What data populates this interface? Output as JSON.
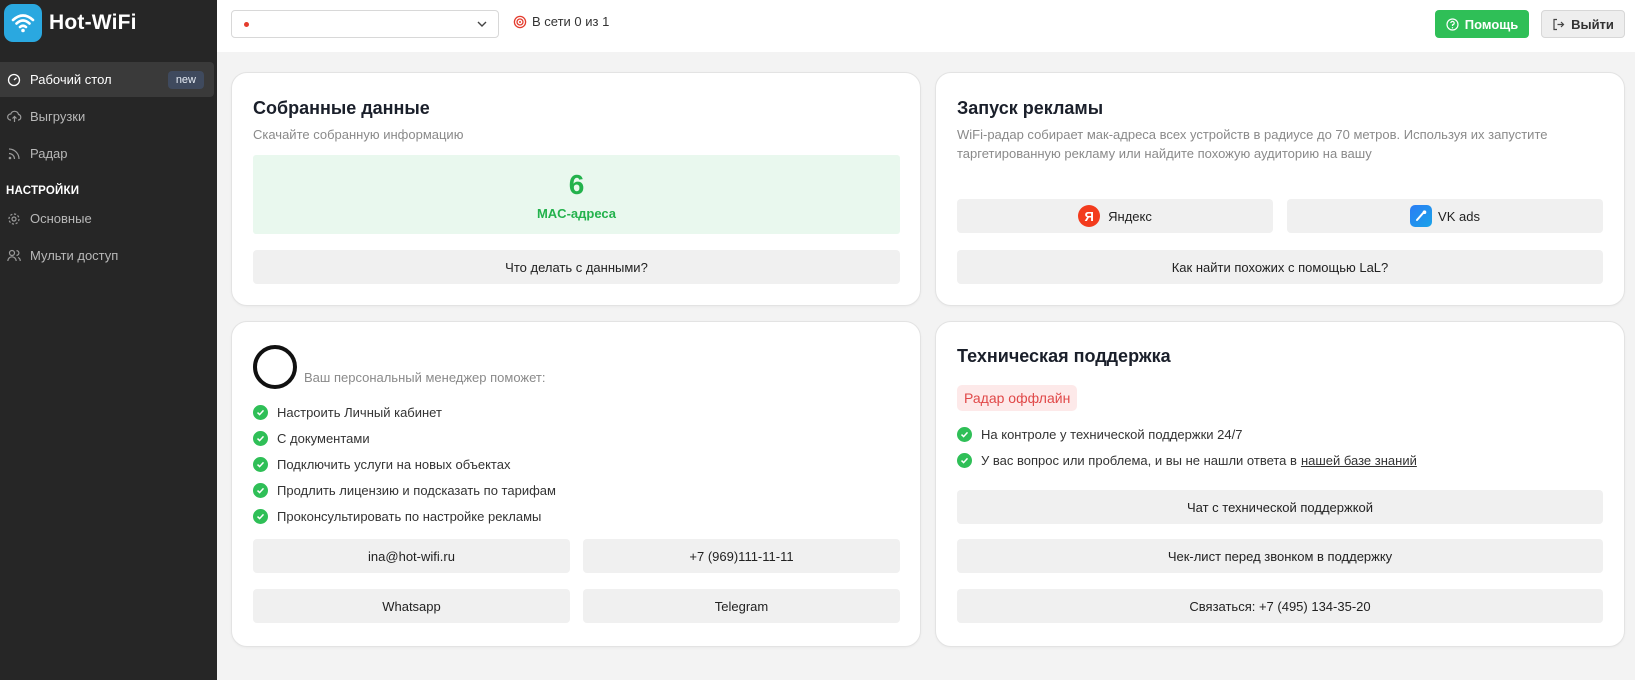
{
  "brand": {
    "name": "Hot-WiFi",
    "color": "#2aa8e0"
  },
  "sidebar": {
    "items": [
      {
        "label": "Рабочий стол",
        "icon": "dashboard-icon",
        "badge": "new",
        "active": true
      },
      {
        "label": "Выгрузки",
        "icon": "cloud-upload-icon"
      },
      {
        "label": "Радар",
        "icon": "rss-icon"
      }
    ],
    "section_title": "НАСТРОЙКИ",
    "settings_items": [
      {
        "label": "Основные",
        "icon": "gear-icon"
      },
      {
        "label": "Мульти доступ",
        "icon": "users-icon"
      }
    ]
  },
  "header": {
    "select_value": "",
    "online_text": "В сети 0 из 1",
    "help_label": "Помощь",
    "exit_label": "Выйти"
  },
  "collected": {
    "title": "Собранные данные",
    "subtitle": "Скачайте собранную информацию",
    "count": "6",
    "count_label": "MAC-адреса",
    "button": "Что делать с данными?"
  },
  "ads": {
    "title": "Запуск рекламы",
    "subtitle": "WiFi-радар собирает мак-адреса всех устройств в радиусе до 70 метров. Используя их запустите таргетированную рекламу или найдите похожую аудиторию на вашу",
    "yandex": "Яндекс",
    "yandex_glyph": "Я",
    "vk": "VK ads",
    "lal_button": "Как найти похожих с помощью LaL?"
  },
  "manager": {
    "title": "Ваш персональный менеджер поможет:",
    "items": [
      "Настроить Личный кабинет",
      "С документами",
      "Подключить услуги на новых объектах",
      "Продлить лицензию и подсказать по тарифам",
      "Проконсультировать по настройке рекламы"
    ],
    "email": "ina@hot-wifi.ru",
    "phone": "+7 (969)111-11-11",
    "whatsapp": "Whatsapp",
    "telegram": "Telegram"
  },
  "support": {
    "title": "Техническая поддержка",
    "status": "Радар оффлайн",
    "items": [
      {
        "text": "На контроле у технической поддержки 24/7"
      },
      {
        "text": "У вас вопрос или проблема, и вы не нашли ответа в",
        "link": "нашей базе знаний"
      }
    ],
    "chat_button": "Чат с технической поддержкой",
    "checklist_button": "Чек-лист перед звонком в поддержку",
    "call_button": "Связаться: +7 (495) 134-35-20"
  },
  "colors": {
    "green": "#2fbf57",
    "red": "#e43b2c",
    "sidebar": "#262626"
  }
}
